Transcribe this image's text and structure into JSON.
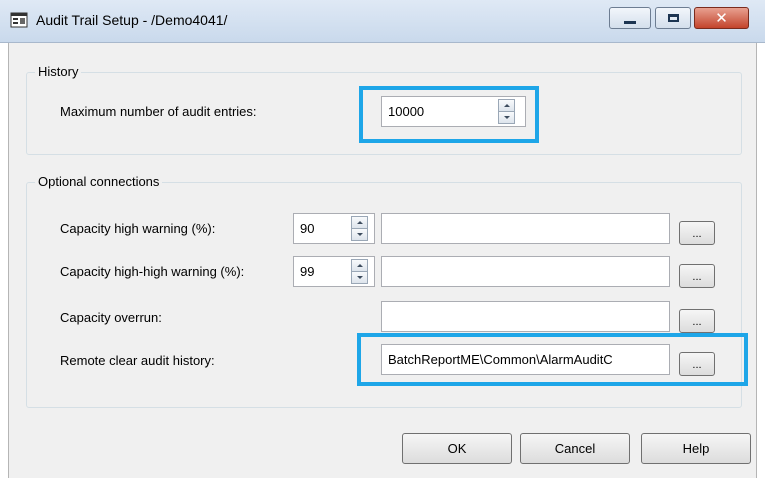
{
  "window": {
    "title": "Audit Trail Setup - /Demo4041/"
  },
  "history": {
    "group_title": "History",
    "max_entries_label": "Maximum number of audit entries:",
    "max_entries_value": "10000"
  },
  "connections": {
    "group_title": "Optional connections",
    "rows": [
      {
        "label": "Capacity high warning (%):",
        "value": "90",
        "connection": ""
      },
      {
        "label": "Capacity high-high warning (%):",
        "value": "99",
        "connection": ""
      },
      {
        "label": "Capacity overrun:",
        "connection": ""
      },
      {
        "label": "Remote clear audit history:",
        "connection": "BatchReportME\\Common\\AlarmAuditC"
      }
    ],
    "browse_label": "..."
  },
  "buttons": {
    "ok": "OK",
    "cancel": "Cancel",
    "help": "Help"
  },
  "colors": {
    "highlight": "#1ea6e8"
  },
  "icons": {
    "app": "app-window-icon",
    "minimize": "minimize-icon",
    "maximize": "maximize-icon",
    "close": "close-icon"
  }
}
